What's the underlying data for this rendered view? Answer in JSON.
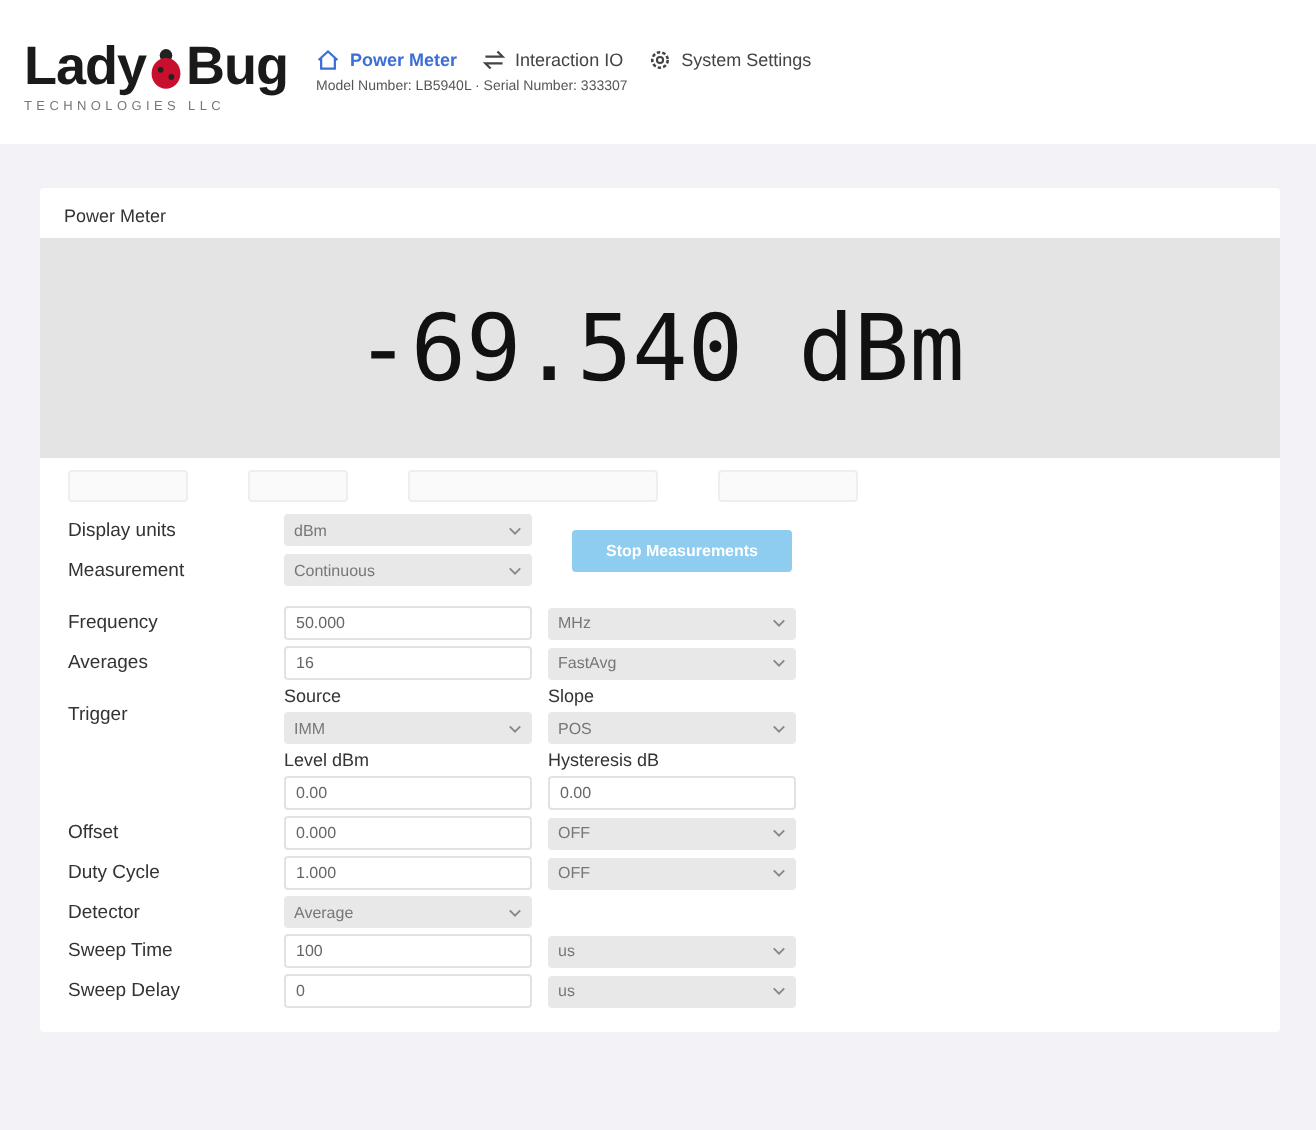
{
  "logo": {
    "brand_start": "Lady",
    "brand_end": "Bug",
    "tagline": "TECHNOLOGIES LLC"
  },
  "nav": [
    {
      "label": "Power Meter",
      "selected": true
    },
    {
      "label": "Interaction IO",
      "selected": false
    },
    {
      "label": "System Settings",
      "selected": false
    }
  ],
  "device_info": "Model Number: LB5940L · Serial Number: 333307",
  "panel": {
    "title": "Power Meter",
    "reading": "-69.540 dBm"
  },
  "top_rows": [
    {
      "label": "Display units",
      "value": "dBm"
    },
    {
      "label": "Measurement",
      "value": "Continuous"
    }
  ],
  "action_button": "Stop Measurements",
  "rows": [
    {
      "kind": "input-select",
      "label": "Frequency",
      "value": "50.000",
      "option": "MHz"
    },
    {
      "kind": "input-select",
      "label": "Averages",
      "value": "16",
      "option": "FastAvg"
    },
    {
      "kind": "trigger",
      "label": "Trigger",
      "source_label": "Source",
      "source": "IMM",
      "slope_label": "Slope",
      "slope": "POS",
      "level_label": "Level dBm",
      "level": "0.00",
      "hysteresis_label": "Hysteresis dB",
      "hysteresis": "0.00"
    },
    {
      "kind": "input-select",
      "label": "Offset",
      "value": "0.000",
      "option": "OFF"
    },
    {
      "kind": "input-select",
      "label": "Duty Cycle",
      "value": "1.000",
      "option": "OFF"
    },
    {
      "kind": "select",
      "label": "Detector",
      "value": "Average"
    },
    {
      "kind": "input-select",
      "label": "Sweep Time",
      "value": "100",
      "option": "us"
    },
    {
      "kind": "input-select",
      "label": "Sweep Delay",
      "value": "0",
      "option": "us"
    }
  ]
}
